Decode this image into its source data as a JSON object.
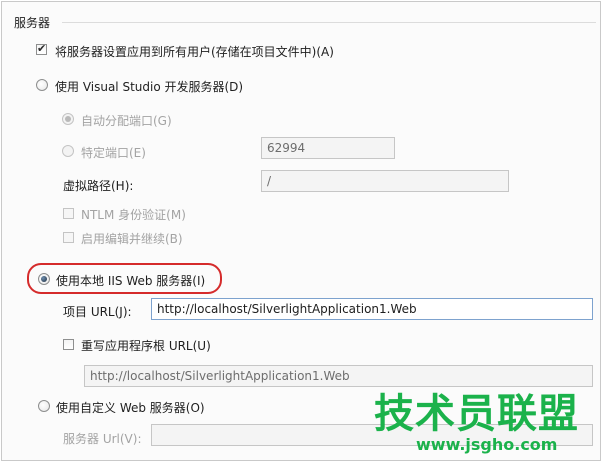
{
  "section": {
    "title": "服务器"
  },
  "apply_all": {
    "label": "将服务器设置应用到所有用户(存储在项目文件中)(A)",
    "checked": true
  },
  "vs_server": {
    "label": "使用 Visual Studio 开发服务器(D)",
    "selected": false,
    "auto_port": {
      "label": "自动分配端口(G)",
      "selected": true
    },
    "specific_port": {
      "label": "特定端口(E)",
      "value": "62994"
    },
    "virtual_path": {
      "label": "虚拟路径(H):",
      "value": "/"
    },
    "ntlm": {
      "label": "NTLM 身份验证(M)"
    },
    "edit_continue": {
      "label": "启用编辑并继续(B)"
    }
  },
  "iis_server": {
    "label": "使用本地 IIS Web 服务器(I)",
    "selected": true,
    "project_url": {
      "label": "项目 URL(J):",
      "value": "http://localhost/SilverlightApplication1.Web"
    },
    "override_root": {
      "label": "重写应用程序根 URL(U)",
      "value": "http://localhost/SilverlightApplication1.Web"
    }
  },
  "custom_server": {
    "label": "使用自定义 Web 服务器(O)",
    "selected": false,
    "server_url": {
      "label": "服务器 Url(V):"
    }
  },
  "watermark": {
    "title": "技术员联盟",
    "url": "www.jsgho.com"
  },
  "colors": {
    "highlight_border": "#d52b2b",
    "watermark": "#1bb24b"
  }
}
